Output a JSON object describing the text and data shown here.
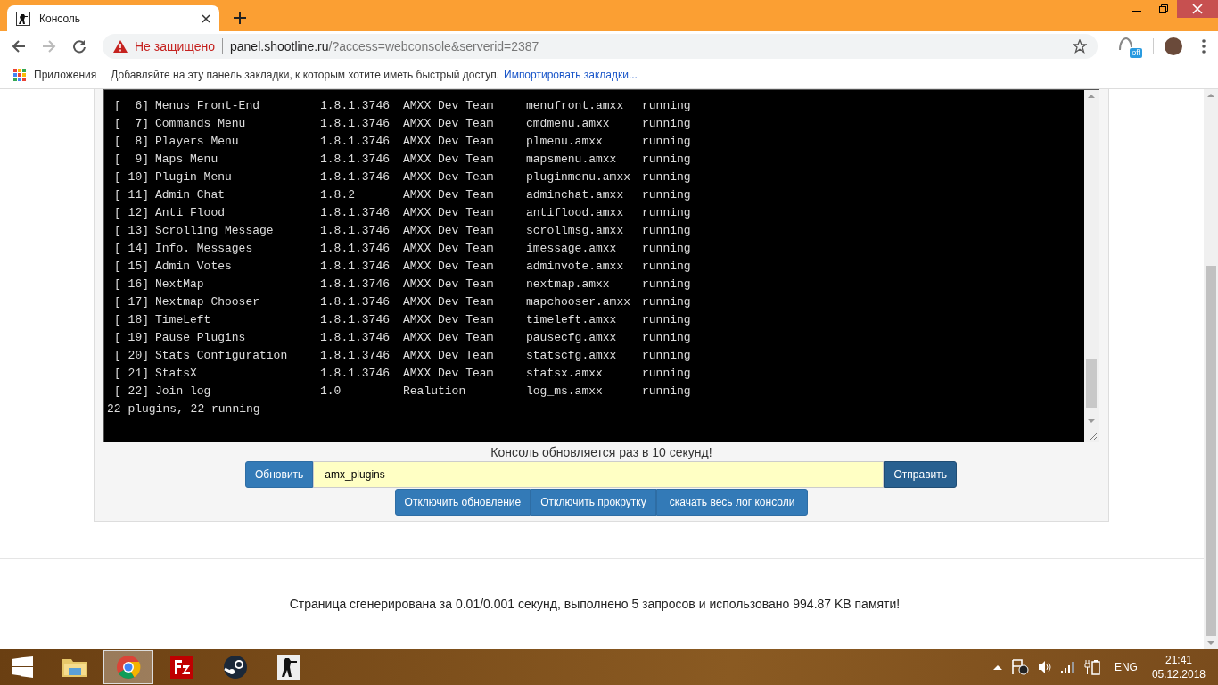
{
  "browser": {
    "tab": {
      "title": "Консоль",
      "selected": true
    },
    "address": {
      "security": "Не защищено",
      "host": "panel.shootline.ru",
      "path": "/?access=webconsole&serverid=2387"
    },
    "extension_badge": "off",
    "bookmarks": {
      "apps": "Приложения",
      "hint": "Добавляйте на эту панель закладки, к которым хотите иметь быстрый доступ.",
      "import_link": "Импортировать закладки..."
    }
  },
  "console": {
    "rows": [
      {
        "index": "[  6]",
        "name": "Menus Front-End",
        "version": "1.8.1.3746",
        "author": "AMXX Dev Team",
        "file": "menufront.amxx",
        "status": "running"
      },
      {
        "index": "[  7]",
        "name": "Commands Menu",
        "version": "1.8.1.3746",
        "author": "AMXX Dev Team",
        "file": "cmdmenu.amxx",
        "status": "running"
      },
      {
        "index": "[  8]",
        "name": "Players Menu",
        "version": "1.8.1.3746",
        "author": "AMXX Dev Team",
        "file": "plmenu.amxx",
        "status": "running"
      },
      {
        "index": "[  9]",
        "name": "Maps Menu",
        "version": "1.8.1.3746",
        "author": "AMXX Dev Team",
        "file": "mapsmenu.amxx",
        "status": "running"
      },
      {
        "index": "[ 10]",
        "name": "Plugin Menu",
        "version": "1.8.1.3746",
        "author": "AMXX Dev Team",
        "file": "pluginmenu.amxx",
        "status": "running"
      },
      {
        "index": "[ 11]",
        "name": "Admin Chat",
        "version": "1.8.2",
        "author": "AMXX Dev Team",
        "file": "adminchat.amxx",
        "status": "running"
      },
      {
        "index": "[ 12]",
        "name": "Anti Flood",
        "version": "1.8.1.3746",
        "author": "AMXX Dev Team",
        "file": "antiflood.amxx",
        "status": "running"
      },
      {
        "index": "[ 13]",
        "name": "Scrolling Message",
        "version": "1.8.1.3746",
        "author": "AMXX Dev Team",
        "file": "scrollmsg.amxx",
        "status": "running"
      },
      {
        "index": "[ 14]",
        "name": "Info. Messages",
        "version": "1.8.1.3746",
        "author": "AMXX Dev Team",
        "file": "imessage.amxx",
        "status": "running"
      },
      {
        "index": "[ 15]",
        "name": "Admin Votes",
        "version": "1.8.1.3746",
        "author": "AMXX Dev Team",
        "file": "adminvote.amxx",
        "status": "running"
      },
      {
        "index": "[ 16]",
        "name": "NextMap",
        "version": "1.8.1.3746",
        "author": "AMXX Dev Team",
        "file": "nextmap.amxx",
        "status": "running"
      },
      {
        "index": "[ 17]",
        "name": "Nextmap Chooser",
        "version": "1.8.1.3746",
        "author": "AMXX Dev Team",
        "file": "mapchooser.amxx",
        "status": "running"
      },
      {
        "index": "[ 18]",
        "name": "TimeLeft",
        "version": "1.8.1.3746",
        "author": "AMXX Dev Team",
        "file": "timeleft.amxx",
        "status": "running"
      },
      {
        "index": "[ 19]",
        "name": "Pause Plugins",
        "version": "1.8.1.3746",
        "author": "AMXX Dev Team",
        "file": "pausecfg.amxx",
        "status": "running"
      },
      {
        "index": "[ 20]",
        "name": "Stats Configuration",
        "version": "1.8.1.3746",
        "author": "AMXX Dev Team",
        "file": "statscfg.amxx",
        "status": "running"
      },
      {
        "index": "[ 21]",
        "name": "StatsX",
        "version": "1.8.1.3746",
        "author": "AMXX Dev Team",
        "file": "statsx.amxx",
        "status": "running"
      },
      {
        "index": "[ 22]",
        "name": "Join log",
        "version": "1.0",
        "author": "Realution",
        "file": "log_ms.amxx",
        "status": "running"
      }
    ],
    "summary": "22 plugins, 22 running"
  },
  "notice": "Консоль обновляется раз в 10 секунд!",
  "command": {
    "refresh_button": "Обновить",
    "value": "amx_plugins",
    "send_button": "Отправить"
  },
  "actions": [
    "Отключить обновление",
    "Отключить прокрутку",
    "скачать весь лог консоли"
  ],
  "footer": "Страница сгенерирована за 0.01/0.001 секунд, выполнено 5 запросов и использовано 994.87 KB памяти!",
  "taskbar": {
    "apps": [
      {
        "kind": "explorer",
        "selected": false
      },
      {
        "kind": "chrome",
        "selected": true
      },
      {
        "kind": "filezilla",
        "selected": false
      },
      {
        "kind": "steam",
        "selected": false
      },
      {
        "kind": "cs",
        "selected": false
      }
    ],
    "language": "ENG",
    "time": "21:41",
    "date": "05.12.2018"
  }
}
